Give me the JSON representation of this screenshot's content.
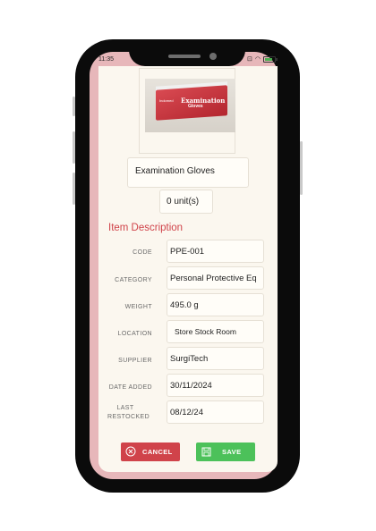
{
  "status_bar": {
    "time": "11:35"
  },
  "product": {
    "name": "Examination Gloves",
    "quantity": "0 unit(s)",
    "image": {
      "box_title": "Examination",
      "box_subtitle": "Gloves",
      "box_brand": "Indomed",
      "box_color": "#c93038"
    }
  },
  "section": {
    "title": "Item Description"
  },
  "fields": [
    {
      "label": "CODE",
      "value": "PPE-001"
    },
    {
      "label": "CATEGORY",
      "value": "Personal Protective Eq"
    },
    {
      "label": "WEIGHT",
      "value": "495.0 g"
    },
    {
      "label": "LOCATION",
      "value": "Store Stock Room"
    },
    {
      "label": "SUPPLIER",
      "value": "SurgiTech"
    },
    {
      "label": "DATE ADDED",
      "value": "30/11/2024"
    },
    {
      "label": "LAST RESTOCKED",
      "value": "08/12/24"
    }
  ],
  "actions": {
    "cancel_label": "CANCEL",
    "save_label": "SAVE"
  },
  "colors": {
    "accent": "#d0434a",
    "save": "#4cc15a",
    "frame": "#e7b7ba"
  },
  "icons": {
    "cancel": "close-circle-icon",
    "save": "floppy-disk-icon"
  }
}
